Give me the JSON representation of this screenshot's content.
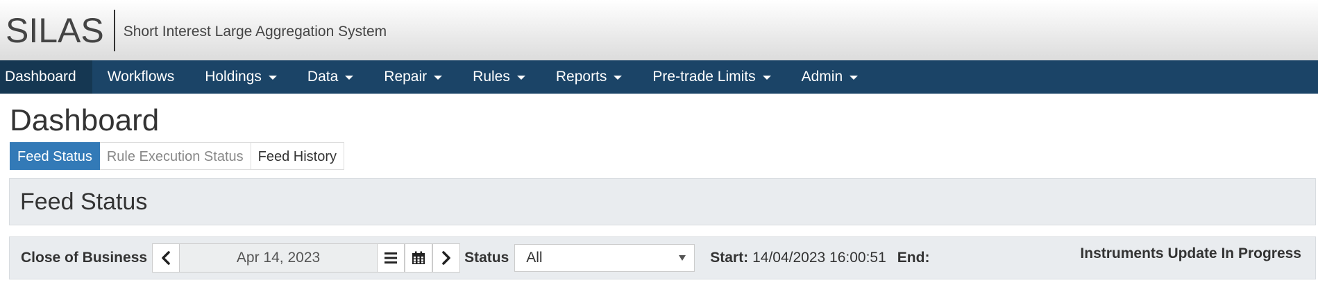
{
  "app": {
    "logo": "SILAS",
    "tagline": "Short Interest Large Aggregation System"
  },
  "nav": {
    "items": [
      {
        "label": "Dashboard",
        "dropdown": false,
        "active": true
      },
      {
        "label": "Workflows",
        "dropdown": false
      },
      {
        "label": "Holdings",
        "dropdown": true
      },
      {
        "label": "Data",
        "dropdown": true
      },
      {
        "label": "Repair",
        "dropdown": true
      },
      {
        "label": "Rules",
        "dropdown": true
      },
      {
        "label": "Reports",
        "dropdown": true
      },
      {
        "label": "Pre-trade Limits",
        "dropdown": true
      },
      {
        "label": "Admin",
        "dropdown": true
      }
    ]
  },
  "page": {
    "title": "Dashboard",
    "tabs": [
      {
        "label": "Feed Status",
        "active": true
      },
      {
        "label": "Rule Execution Status",
        "muted": true
      },
      {
        "label": "Feed History"
      }
    ],
    "section_title": "Feed Status"
  },
  "filter": {
    "cob_label": "Close of Business",
    "date_value": "Apr 14, 2023",
    "status_label": "Status",
    "status_value": "All",
    "start_label": "Start:",
    "start_value": "14/04/2023 16:00:51",
    "end_label": "End:",
    "progress_text": "Instruments Update In Progress"
  },
  "icons": {
    "prev": "chevron-left-icon",
    "list": "list-icon",
    "calendar": "calendar-icon",
    "next": "chevron-right-icon"
  },
  "colors": {
    "navbar": "#1b4467",
    "nav_active": "#153752",
    "tab_active": "#337ab7",
    "panel_bg": "#e9ecef"
  }
}
